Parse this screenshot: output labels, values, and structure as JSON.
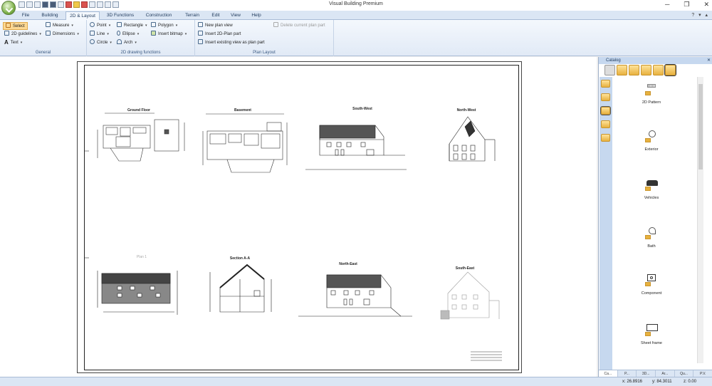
{
  "app": {
    "title": "Visual Building Premium"
  },
  "window_controls": {
    "minimize": "─",
    "maximize": "❐",
    "close": "✕"
  },
  "ribbon_tabs": [
    {
      "label": "File",
      "active": false
    },
    {
      "label": "Building",
      "active": false
    },
    {
      "label": "2D & Layout",
      "active": true
    },
    {
      "label": "3D Functions",
      "active": false
    },
    {
      "label": "Construction",
      "active": false
    },
    {
      "label": "Terrain",
      "active": false
    },
    {
      "label": "Edit",
      "active": false
    },
    {
      "label": "View",
      "active": false
    },
    {
      "label": "Help",
      "active": false
    }
  ],
  "ribbon": {
    "general": {
      "label": "General",
      "select": "Select",
      "guidelines": "2D guidelines",
      "text": "Text",
      "measure": "Measure",
      "dimensions": "Dimensions"
    },
    "drawing": {
      "label": "2D drawing functions",
      "point": "Point",
      "line": "Line",
      "circle": "Circle",
      "rectangle": "Rectangle",
      "ellipse": "Ellipse",
      "arch": "Arch",
      "polygon": "Polygon",
      "insert_bitmap": "Insert bitmap"
    },
    "plan_layout": {
      "label": "Plan Layout",
      "new_plan_view": "New plan view",
      "insert_2d_plan": "Insert 2D-Plan part",
      "insert_existing": "Insert existing view as plan part",
      "delete_part": "Delete current plan part"
    }
  },
  "sheet": {
    "plans": [
      {
        "title": "Ground Floor",
        "style": "floor"
      },
      {
        "title": "Basement",
        "style": "floor"
      },
      {
        "title": "South-West",
        "style": "elevation"
      },
      {
        "title": "North-West",
        "style": "gable"
      },
      {
        "title": "Plan 1",
        "style": "roof"
      },
      {
        "title": "Section A-A",
        "style": "section"
      },
      {
        "title": "North-East",
        "style": "elevation"
      },
      {
        "title": "South-East",
        "style": "gable-light"
      }
    ]
  },
  "catalog": {
    "title": "Catalog",
    "items": [
      {
        "label": "2D Pattern",
        "icon": "pattern-icon"
      },
      {
        "label": "Exterior",
        "icon": "tree-icon"
      },
      {
        "label": "Vehicles",
        "icon": "car-icon"
      },
      {
        "label": "Bath",
        "icon": "shower-icon"
      },
      {
        "label": "Component",
        "icon": "component-icon"
      },
      {
        "label": "Sheet frame",
        "icon": "frame-icon"
      }
    ],
    "tabs": [
      "Ca...",
      "P...",
      "3D...",
      "Ar...",
      "Qu...",
      "P.V."
    ]
  },
  "status": {
    "x": "x: 26.8916",
    "y": "y: 84.3011",
    "z": "z: 0.00"
  }
}
